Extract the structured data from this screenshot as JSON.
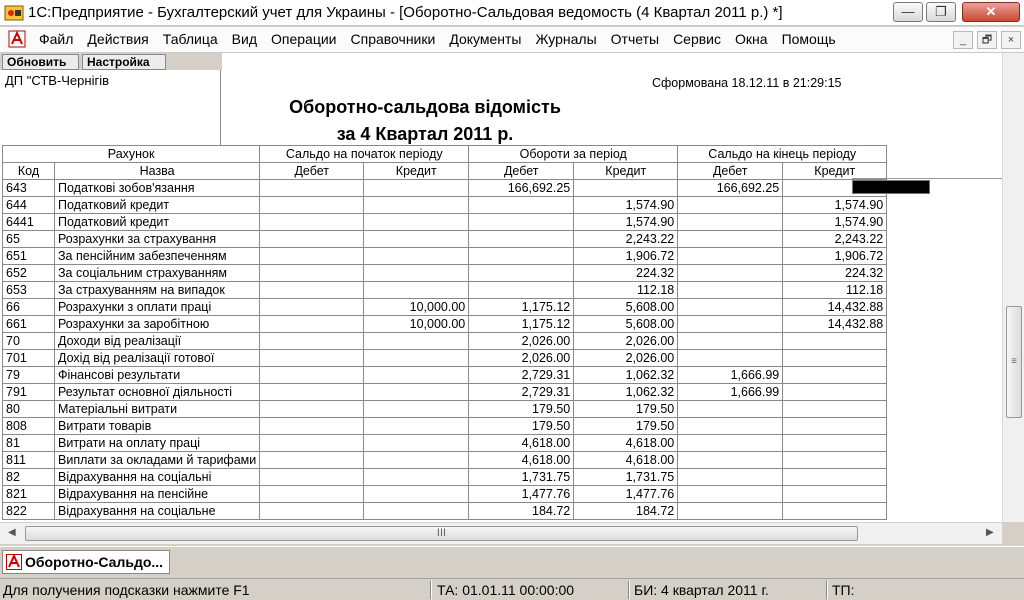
{
  "window": {
    "title": "1С:Предприятие - Бухгалтерский учет для Украины - [Оборотно-Сальдовая ведомость (4 Квартал 2011 р.)  *]",
    "btn_min": "—",
    "btn_max": "❐",
    "btn_close": "✕"
  },
  "menu": [
    "Файл",
    "Действия",
    "Таблица",
    "Вид",
    "Операции",
    "Справочники",
    "Документы",
    "Журналы",
    "Отчеты",
    "Сервис",
    "Окна",
    "Помощь"
  ],
  "mdi": {
    "min": "_",
    "restore": "🗗",
    "close": "×"
  },
  "toolbar": {
    "refresh": "Обновить",
    "settings": "Настройка"
  },
  "report": {
    "org": "ДП \"СТВ-Чернігів",
    "formed": "Сформована 18.12.11 в 21:29:15",
    "title1": "Оборотно-сальдова відомість",
    "title2": "за 4 Квартал 2011 р.",
    "headers": {
      "account": "Рахунок",
      "start": "Сальдо на початок періоду",
      "turnover": "Обороти за період",
      "end": "Сальдо на кінець періоду",
      "code": "Код",
      "name": "Назва",
      "debit": "Дебет",
      "credit": "Кредит"
    },
    "rows": [
      {
        "code": "643",
        "name": "Податкові зобов'язання",
        "sd": "",
        "sk": "",
        "od": "166,692.25",
        "ok": "",
        "ed": "166,692.25",
        "ek": ""
      },
      {
        "code": "644",
        "name": "Податковий кредит",
        "sd": "",
        "sk": "",
        "od": "",
        "ok": "1,574.90",
        "ed": "",
        "ek": "1,574.90"
      },
      {
        "code": "6441",
        "name": "Податковий кредит",
        "sd": "",
        "sk": "",
        "od": "",
        "ok": "1,574.90",
        "ed": "",
        "ek": "1,574.90"
      },
      {
        "code": "65",
        "name": "Розрахунки за страхування",
        "sd": "",
        "sk": "",
        "od": "",
        "ok": "2,243.22",
        "ed": "",
        "ek": "2,243.22"
      },
      {
        "code": "651",
        "name": "За пенсійним забезпеченням",
        "sd": "",
        "sk": "",
        "od": "",
        "ok": "1,906.72",
        "ed": "",
        "ek": "1,906.72"
      },
      {
        "code": "652",
        "name": "За соціальним страхуванням",
        "sd": "",
        "sk": "",
        "od": "",
        "ok": "224.32",
        "ed": "",
        "ek": "224.32"
      },
      {
        "code": "653",
        "name": "За страхуванням на випадок",
        "sd": "",
        "sk": "",
        "od": "",
        "ok": "112.18",
        "ed": "",
        "ek": "112.18"
      },
      {
        "code": "66",
        "name": "Розрахунки з оплати праці",
        "sd": "",
        "sk": "10,000.00",
        "od": "1,175.12",
        "ok": "5,608.00",
        "ed": "",
        "ek": "14,432.88"
      },
      {
        "code": "661",
        "name": "Розрахунки за заробітною",
        "sd": "",
        "sk": "10,000.00",
        "od": "1,175.12",
        "ok": "5,608.00",
        "ed": "",
        "ek": "14,432.88"
      },
      {
        "code": "70",
        "name": "Доходи від реалізації",
        "sd": "",
        "sk": "",
        "od": "2,026.00",
        "ok": "2,026.00",
        "ed": "",
        "ek": ""
      },
      {
        "code": "701",
        "name": "Дохід від реалізації готової",
        "sd": "",
        "sk": "",
        "od": "2,026.00",
        "ok": "2,026.00",
        "ed": "",
        "ek": ""
      },
      {
        "code": "79",
        "name": "Фінансові результати",
        "sd": "",
        "sk": "",
        "od": "2,729.31",
        "ok": "1,062.32",
        "ed": "1,666.99",
        "ek": ""
      },
      {
        "code": "791",
        "name": "Результат основної діяльності",
        "sd": "",
        "sk": "",
        "od": "2,729.31",
        "ok": "1,062.32",
        "ed": "1,666.99",
        "ek": ""
      },
      {
        "code": "80",
        "name": "Матеріальні витрати",
        "sd": "",
        "sk": "",
        "od": "179.50",
        "ok": "179.50",
        "ed": "",
        "ek": ""
      },
      {
        "code": "808",
        "name": "Витрати товарів",
        "sd": "",
        "sk": "",
        "od": "179.50",
        "ok": "179.50",
        "ed": "",
        "ek": ""
      },
      {
        "code": "81",
        "name": "Витрати на оплату праці",
        "sd": "",
        "sk": "",
        "od": "4,618.00",
        "ok": "4,618.00",
        "ed": "",
        "ek": ""
      },
      {
        "code": "811",
        "name": "Виплати за окладами й тарифами",
        "sd": "",
        "sk": "",
        "od": "4,618.00",
        "ok": "4,618.00",
        "ed": "",
        "ek": ""
      },
      {
        "code": "82",
        "name": "Відрахування на соціальні",
        "sd": "",
        "sk": "",
        "od": "1,731.75",
        "ok": "1,731.75",
        "ed": "",
        "ek": ""
      },
      {
        "code": "821",
        "name": "Відрахування на пенсійне",
        "sd": "",
        "sk": "",
        "od": "1,477.76",
        "ok": "1,477.76",
        "ed": "",
        "ek": ""
      },
      {
        "code": "822",
        "name": "Відрахування на соціальне",
        "sd": "",
        "sk": "",
        "od": "184.72",
        "ok": "184.72",
        "ed": "",
        "ek": ""
      }
    ]
  },
  "scroll": {
    "left_arrow": "◀",
    "right_arrow": "▶",
    "grip": "III",
    "vgrip": "≡"
  },
  "task_tab": "Оборотно-Сальдо...",
  "status": {
    "hint": "Для получения подсказки нажмите F1",
    "ta": "ТА: 01.01.11  00:00:00",
    "bi": "БИ: 4 квартал 2011 г.",
    "tp": "ТП:"
  }
}
